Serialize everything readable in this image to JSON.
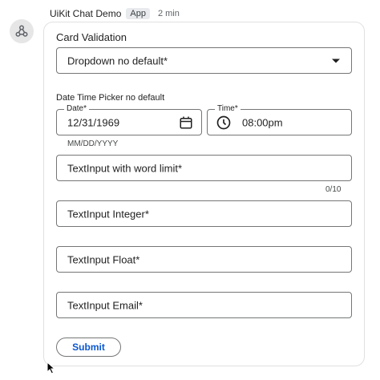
{
  "message": {
    "sender": "UiKit Chat Demo",
    "badge": "App",
    "time": "2 min",
    "avatar_icon": "webhook-icon"
  },
  "card": {
    "title": "Card Validation",
    "dropdown": {
      "label": "Dropdown no default*"
    },
    "date_time_section": {
      "label": "Date Time Picker no default",
      "date": {
        "label": "Date",
        "required": "*",
        "value": "12/31/1969",
        "helper": "MM/DD/YYYY",
        "icon": "calendar-icon"
      },
      "time": {
        "label": "Time",
        "required": "*",
        "value": "08:00pm",
        "icon": "clock-icon"
      }
    },
    "inputs": {
      "word_limit": {
        "label": "TextInput with word limit*",
        "counter": "0/10"
      },
      "integer": {
        "label": "TextInput Integer*"
      },
      "float": {
        "label": "TextInput Float*"
      },
      "email": {
        "label": "TextInput Email*"
      }
    },
    "submit_label": "Submit"
  },
  "colors": {
    "accent": "#0b57d0",
    "border": "#747775",
    "card_border": "#e0e0e0"
  }
}
